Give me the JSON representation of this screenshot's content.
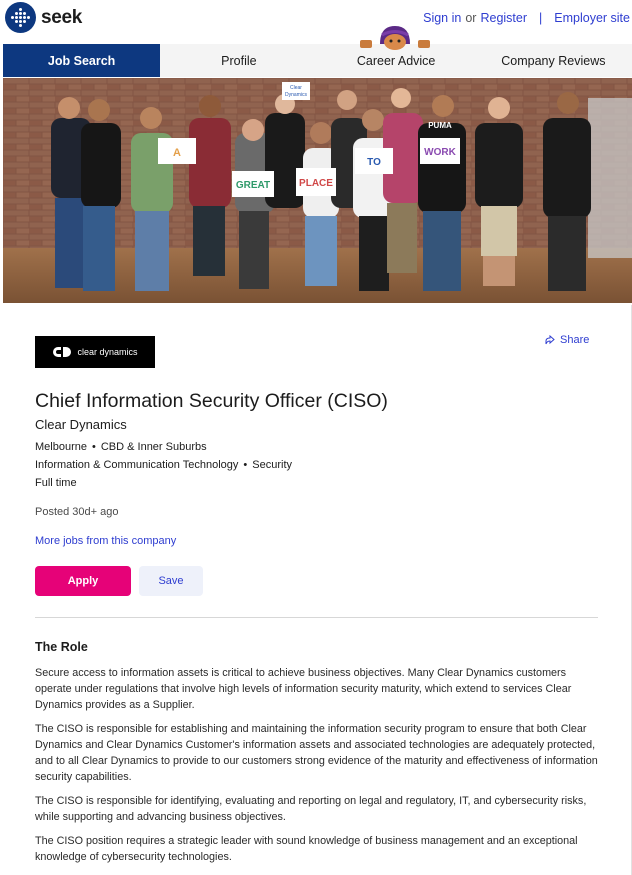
{
  "header": {
    "logo_text": "seek",
    "sign_in": "Sign in",
    "or": "or",
    "register": "Register",
    "separator": "|",
    "employer_site": "Employer site"
  },
  "nav": {
    "tabs": [
      {
        "label": "Job Search",
        "active": true
      },
      {
        "label": "Profile",
        "active": false
      },
      {
        "label": "Career Advice",
        "active": false
      },
      {
        "label": "Company Reviews",
        "active": false
      }
    ]
  },
  "hero": {
    "signs": [
      "A",
      "GREAT",
      "PLACE",
      "TO",
      "WORK"
    ],
    "small_sign": [
      "Clear",
      "Dynamics"
    ],
    "shirt_text": "PUMA"
  },
  "job": {
    "company_logo_text": "clear dynamics",
    "share_label": "Share",
    "title": "Chief Information Security Officer (CISO)",
    "company": "Clear Dynamics",
    "location": "Melbourne",
    "area": "CBD & Inner Suburbs",
    "classification": "Information & Communication Technology",
    "subclassification": "Security",
    "work_type": "Full time",
    "bullet": "•",
    "posted": "Posted 30d+ ago",
    "more_jobs": "More jobs from this company",
    "apply_label": "Apply",
    "save_label": "Save"
  },
  "description": {
    "heading": "The Role",
    "paragraphs": [
      "Secure access to information assets is critical to achieve business objectives. Many Clear Dynamics customers operate under regulations that involve high levels of information security maturity, which extend to services Clear Dynamics provides as a Supplier.",
      "The CISO is responsible for establishing and maintaining the information security program to ensure that both Clear Dynamics and Clear Dynamics Customer's information assets and associated technologies are adequately protected, and to all Clear Dynamics to provide to our customers strong evidence of the maturity and effectiveness of information security capabilities.",
      "The CISO is responsible for identifying, evaluating and reporting on legal and regulatory, IT, and cybersecurity risks, while supporting and advancing business objectives.",
      "The CISO position requires a strategic leader with sound knowledge of business management and an exceptional knowledge of cybersecurity technologies."
    ]
  },
  "colors": {
    "brand_navy": "#0d3880",
    "link_blue": "#2e3dd0",
    "apply_pink": "#e60278"
  }
}
